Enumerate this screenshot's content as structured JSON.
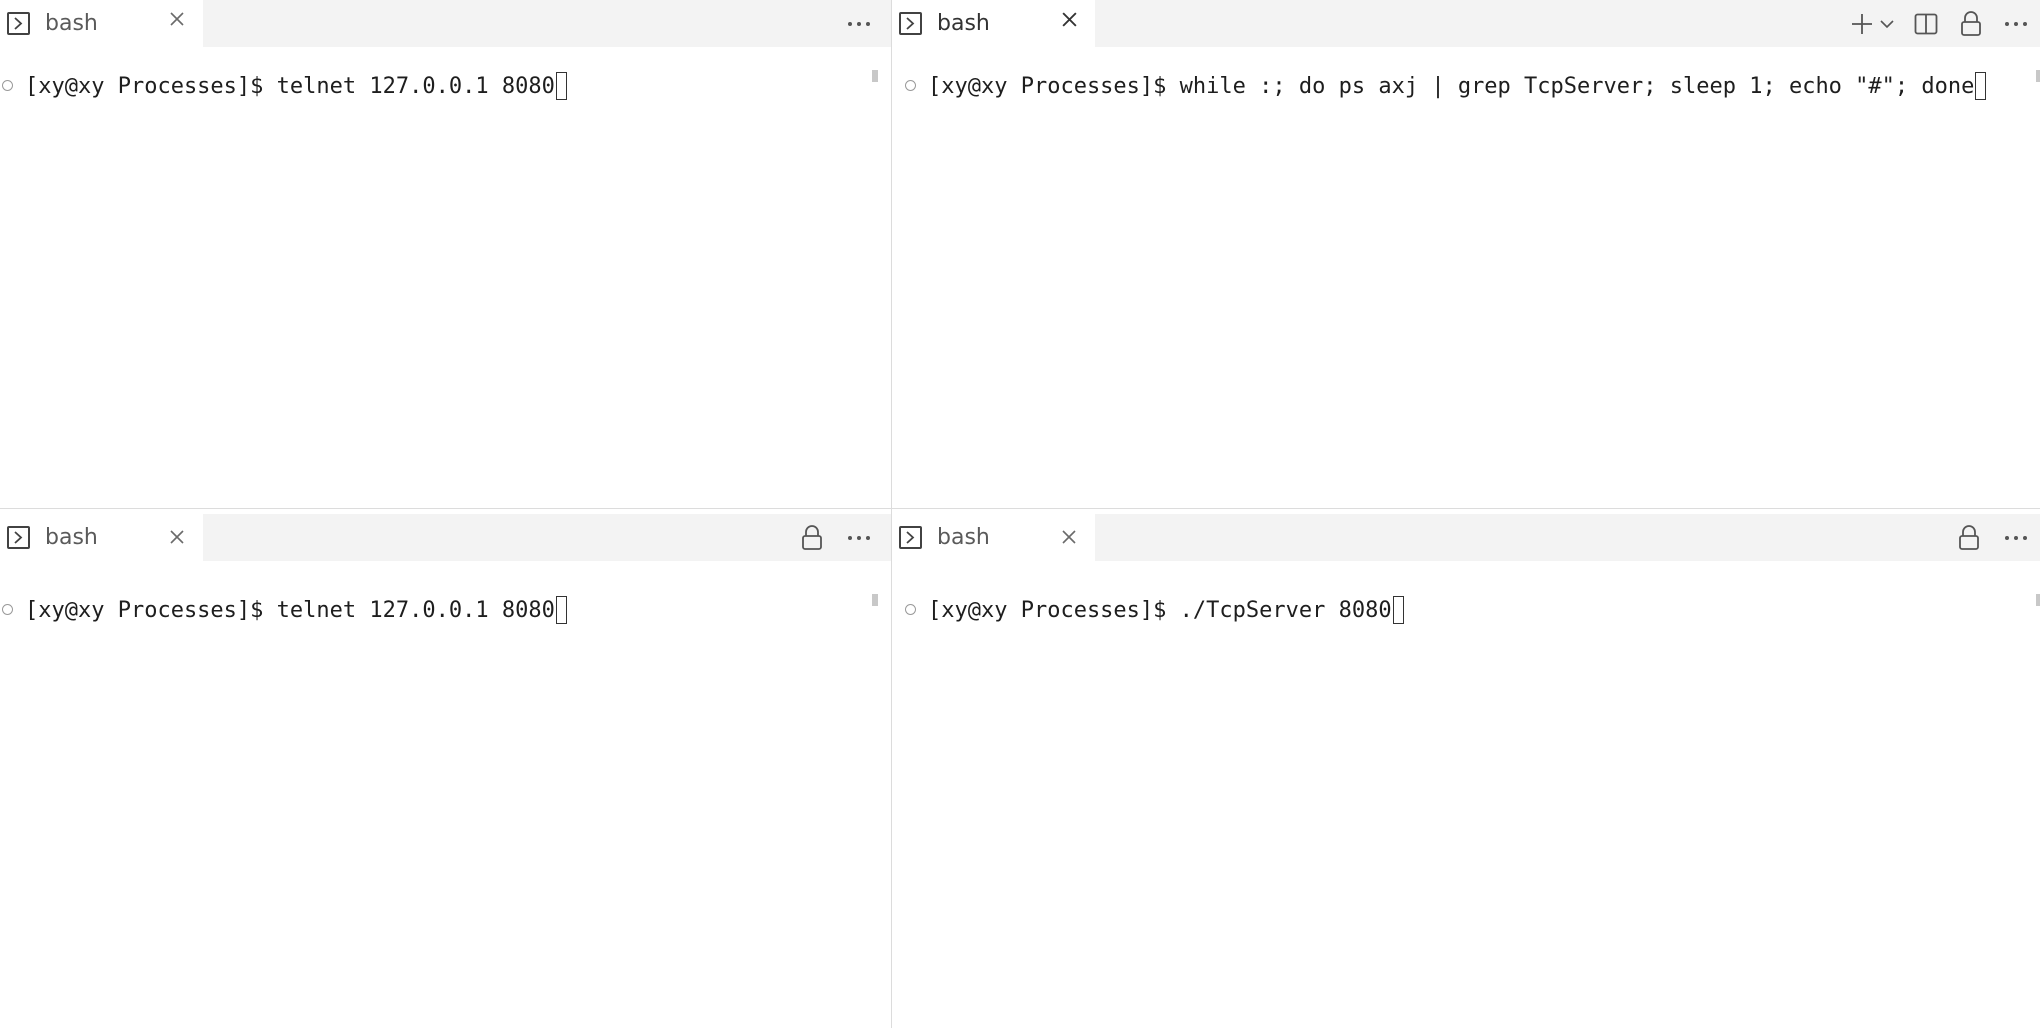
{
  "panes": {
    "top_left": {
      "tab": {
        "title": "bash",
        "icon": "terminal-icon",
        "close": "close-icon"
      },
      "actions": [
        "more-icon"
      ],
      "prompt": "[xy@xy Processes]$ ",
      "command": "telnet 127.0.0.1 8080"
    },
    "top_right": {
      "tab": {
        "title": "bash",
        "icon": "terminal-icon",
        "close": "close-icon"
      },
      "actions": [
        "plus-icon",
        "chevron-down-icon",
        "split-icon",
        "lock-icon",
        "more-icon"
      ],
      "prompt": "[xy@xy Processes]$ ",
      "command": "while :; do ps axj | grep TcpServer; sleep 1; echo \"#\"; done"
    },
    "bottom_left": {
      "tab": {
        "title": "bash",
        "icon": "terminal-icon",
        "close": "close-icon"
      },
      "actions": [
        "lock-icon",
        "more-icon"
      ],
      "prompt": "[xy@xy Processes]$ ",
      "command": "telnet 127.0.0.1 8080"
    },
    "bottom_right": {
      "tab": {
        "title": "bash",
        "icon": "terminal-icon",
        "close": "close-icon"
      },
      "actions": [
        "lock-icon",
        "more-icon"
      ],
      "prompt": "[xy@xy Processes]$ ",
      "command": "./TcpServer 8080"
    }
  },
  "colors": {
    "tabbar_bg": "#f3f3f3",
    "tab_bg": "#ffffff",
    "text": "#1e1e1e",
    "divider": "#dcdcdc"
  }
}
